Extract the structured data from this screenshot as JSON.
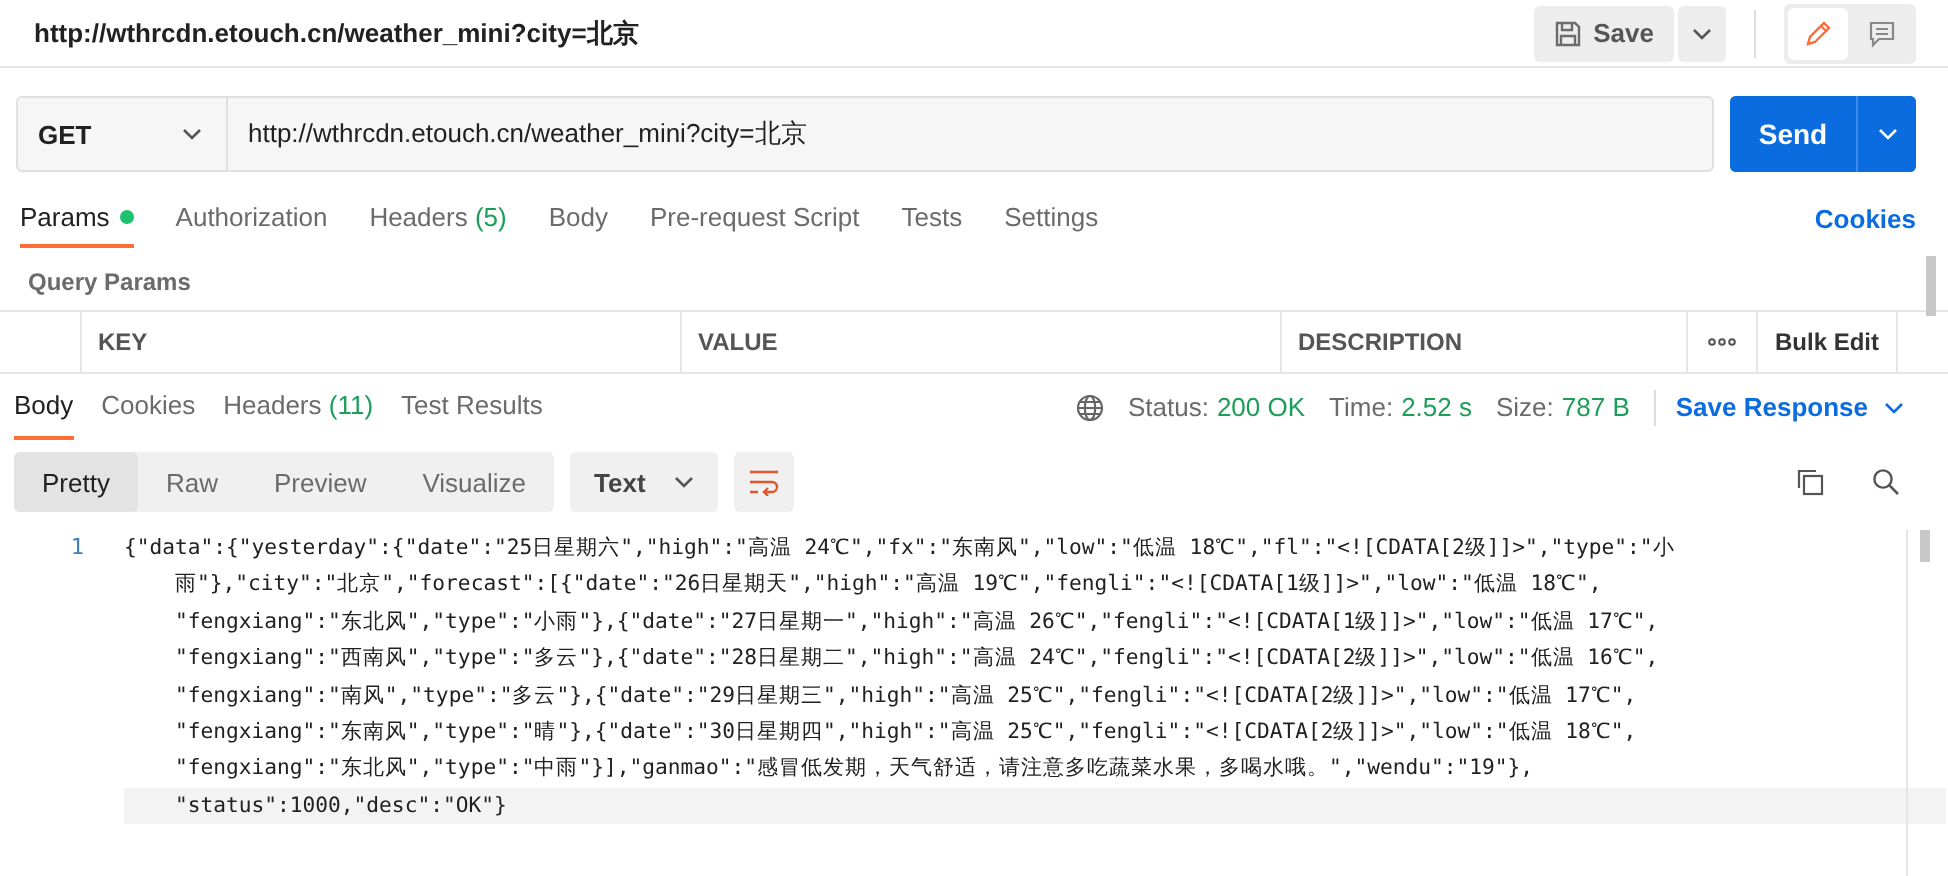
{
  "header": {
    "title": "http://wthrcdn.etouch.cn/weather_mini?city=北京",
    "save_label": "Save",
    "mode_edit_selected": true
  },
  "request": {
    "method": "GET",
    "url": "http://wthrcdn.etouch.cn/weather_mini?city=北京",
    "send_label": "Send"
  },
  "request_tabs": [
    {
      "label": "Params",
      "dot": true,
      "selected": true
    },
    {
      "label": "Authorization",
      "dot": false,
      "selected": false
    },
    {
      "label": "Headers",
      "count": "(5)",
      "dot": false,
      "selected": false
    },
    {
      "label": "Body",
      "dot": false,
      "selected": false
    },
    {
      "label": "Pre-request Script",
      "dot": false,
      "selected": false
    },
    {
      "label": "Tests",
      "dot": false,
      "selected": false
    },
    {
      "label": "Settings",
      "dot": false,
      "selected": false
    }
  ],
  "cookies_link": "Cookies",
  "query_params": {
    "title": "Query Params",
    "columns": [
      "KEY",
      "VALUE",
      "DESCRIPTION"
    ],
    "bulk_edit": "Bulk Edit"
  },
  "response_tabs": [
    {
      "label": "Body",
      "selected": true
    },
    {
      "label": "Cookies",
      "selected": false
    },
    {
      "label": "Headers",
      "count": "(11)",
      "selected": false
    },
    {
      "label": "Test Results",
      "selected": false
    }
  ],
  "response_meta": {
    "status_label": "Status:",
    "status": "200 OK",
    "time_label": "Time:",
    "time": "2.52 s",
    "size_label": "Size:",
    "size": "787 B",
    "save_response": "Save Response"
  },
  "format_tabs": [
    {
      "label": "Pretty",
      "selected": true
    },
    {
      "label": "Raw",
      "selected": false
    },
    {
      "label": "Preview",
      "selected": false
    },
    {
      "label": "Visualize",
      "selected": false
    }
  ],
  "format_type": "Text",
  "code": {
    "line_number": "1",
    "lines": [
      "{\"data\":{\"yesterday\":{\"date\":\"25日星期六\",\"high\":\"高温 24℃\",\"fx\":\"东南风\",\"low\":\"低温 18℃\",\"fl\":\"<![CDATA[2级]]>\",\"type\":\"小",
      "    雨\"},\"city\":\"北京\",\"forecast\":[{\"date\":\"26日星期天\",\"high\":\"高温 19℃\",\"fengli\":\"<![CDATA[1级]]>\",\"low\":\"低温 18℃\",",
      "    \"fengxiang\":\"东北风\",\"type\":\"小雨\"},{\"date\":\"27日星期一\",\"high\":\"高温 26℃\",\"fengli\":\"<![CDATA[1级]]>\",\"low\":\"低温 17℃\",",
      "    \"fengxiang\":\"西南风\",\"type\":\"多云\"},{\"date\":\"28日星期二\",\"high\":\"高温 24℃\",\"fengli\":\"<![CDATA[2级]]>\",\"low\":\"低温 16℃\",",
      "    \"fengxiang\":\"南风\",\"type\":\"多云\"},{\"date\":\"29日星期三\",\"high\":\"高温 25℃\",\"fengli\":\"<![CDATA[2级]]>\",\"low\":\"低温 17℃\",",
      "    \"fengxiang\":\"东南风\",\"type\":\"晴\"},{\"date\":\"30日星期四\",\"high\":\"高温 25℃\",\"fengli\":\"<![CDATA[2级]]>\",\"low\":\"低温 18℃\",",
      "    \"fengxiang\":\"东北风\",\"type\":\"中雨\"}],\"ganmao\":\"感冒低发期，天气舒适，请注意多吃蔬菜水果，多喝水哦。\",\"wendu\":\"19\"},",
      "    \"status\":1000,\"desc\":\"OK\"}"
    ]
  }
}
